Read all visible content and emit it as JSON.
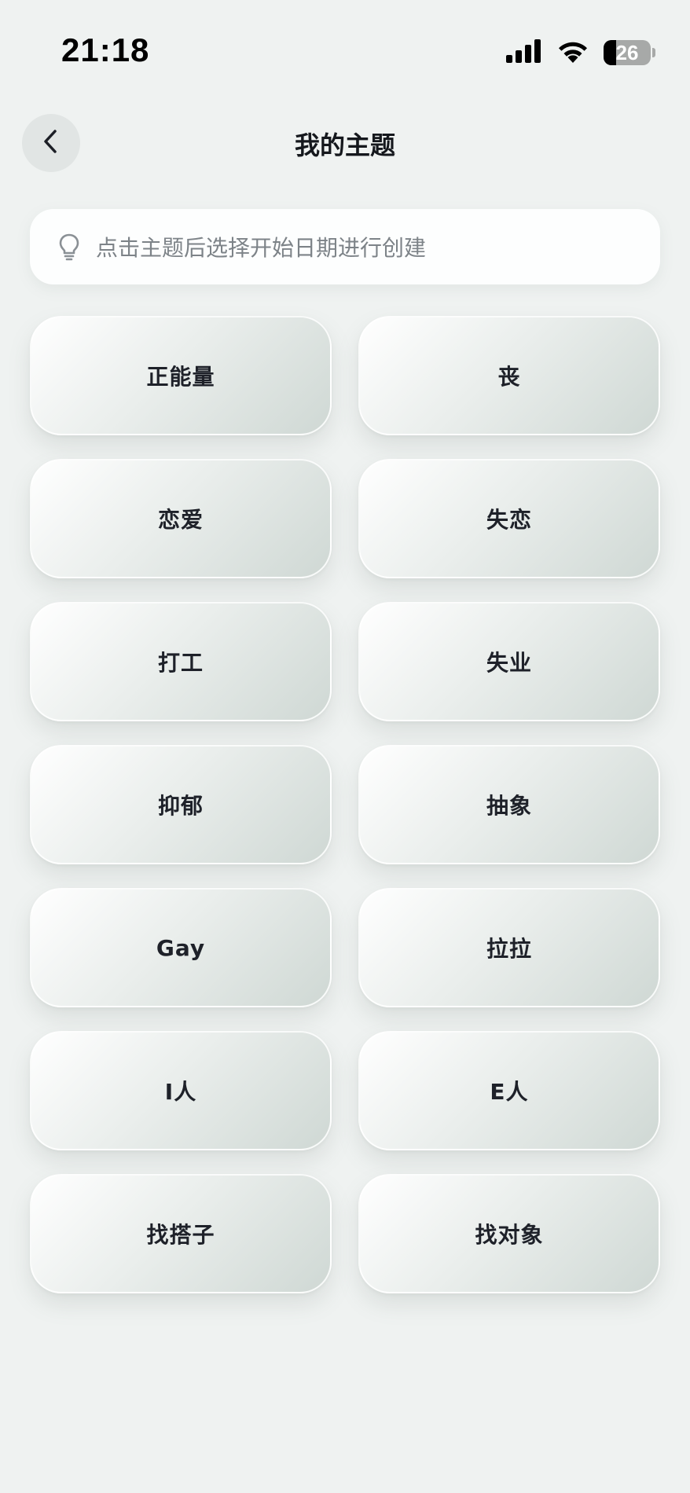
{
  "status_bar": {
    "time": "21:18",
    "battery_level": "26",
    "battery_fraction": 0.26,
    "icons": [
      "cellular-signal-icon",
      "wifi-icon",
      "battery-icon"
    ]
  },
  "nav": {
    "back_icon": "chevron-left-icon",
    "title": "我的主题"
  },
  "tip": {
    "icon": "lightbulb-icon",
    "text": "点击主题后选择开始日期进行创建"
  },
  "topics": [
    {
      "label": "正能量"
    },
    {
      "label": "丧"
    },
    {
      "label": "恋爱"
    },
    {
      "label": "失恋"
    },
    {
      "label": "打工"
    },
    {
      "label": "失业"
    },
    {
      "label": "抑郁"
    },
    {
      "label": "抽象"
    },
    {
      "label": "Gay"
    },
    {
      "label": "拉拉"
    },
    {
      "label": "I人"
    },
    {
      "label": "E人"
    },
    {
      "label": "找搭子"
    },
    {
      "label": "找对象"
    }
  ],
  "colors": {
    "background": "#eff2f1",
    "card_gradient_start": "#ffffff",
    "card_gradient_end": "#cfd8d4",
    "title_text": "#15181d",
    "tip_text": "#7d8388"
  }
}
